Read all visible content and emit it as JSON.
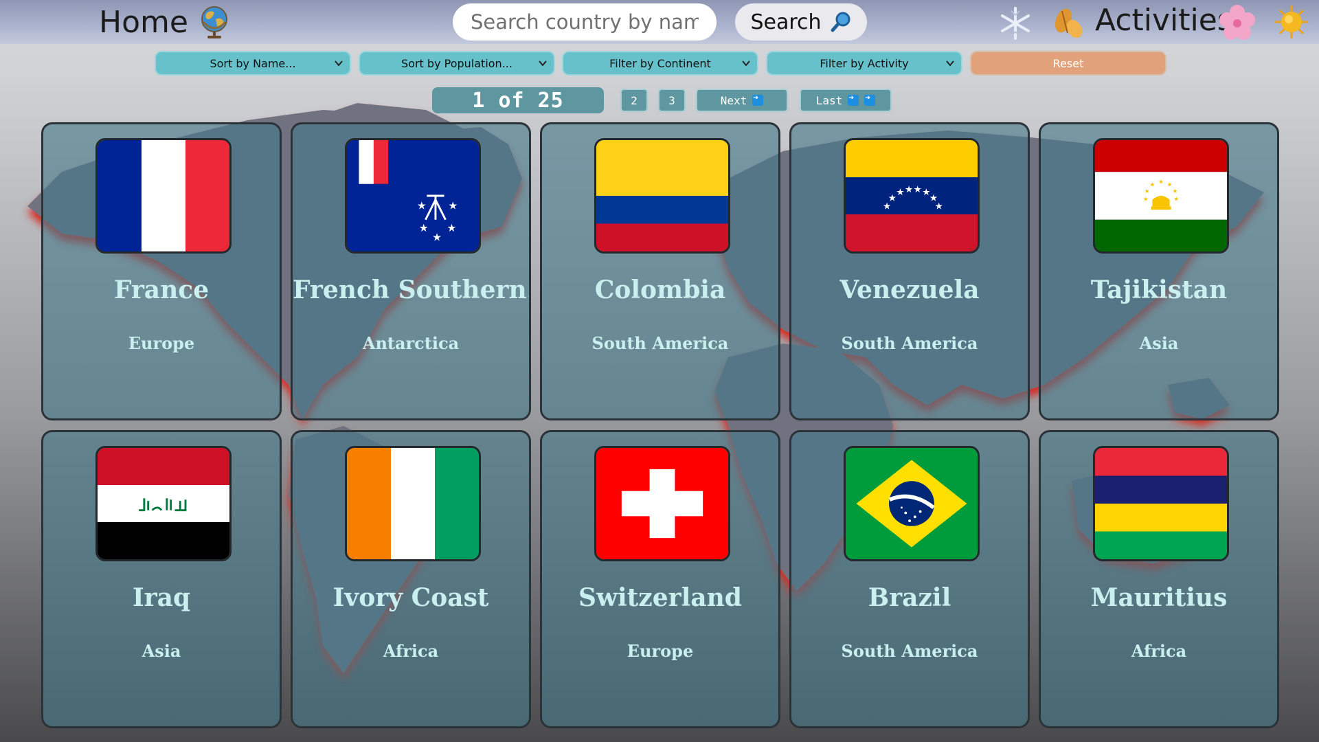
{
  "header": {
    "home_label": "Home",
    "search_placeholder": "Search country by name...",
    "search_button_label": "Search",
    "activities_label": "Activities",
    "icons": [
      "globe-icon",
      "magnifier-icon",
      "snowflake-icon",
      "autumn-leaf-icon",
      "blossom-icon",
      "sun-icon"
    ]
  },
  "filters": {
    "sort_by_name": "Sort by Name...",
    "sort_by_population": "Sort by Population...",
    "filter_by_continent": "Filter by Continent",
    "filter_by_activity": "Filter by Activity",
    "reset_label": "Reset"
  },
  "pagination": {
    "indicator": "1 of 25",
    "page2": "2",
    "page3": "3",
    "next_label": "Next",
    "last_label": "Last"
  },
  "countries": [
    {
      "name": "France",
      "continent": "Europe",
      "flag": "france"
    },
    {
      "name": "French Southern…",
      "continent": "Antarctica",
      "flag": "french-southern"
    },
    {
      "name": "Colombia",
      "continent": "South America",
      "flag": "colombia"
    },
    {
      "name": "Venezuela",
      "continent": "South America",
      "flag": "venezuela"
    },
    {
      "name": "Tajikistan",
      "continent": "Asia",
      "flag": "tajikistan"
    },
    {
      "name": "Iraq",
      "continent": "Asia",
      "flag": "iraq"
    },
    {
      "name": "Ivory Coast",
      "continent": "Africa",
      "flag": "ivory-coast"
    },
    {
      "name": "Switzerland",
      "continent": "Europe",
      "flag": "switzerland"
    },
    {
      "name": "Brazil",
      "continent": "South America",
      "flag": "brazil"
    },
    {
      "name": "Mauritius",
      "continent": "Africa",
      "flag": "mauritius"
    }
  ],
  "colors": {
    "header": "#a9b1cc",
    "filter_select": "#66c1cb",
    "reset": "#e0a17b",
    "card_overlay": "#467989",
    "card_text": "#c9efef",
    "map_land": "#6f7280",
    "map_edge": "#e6322c"
  }
}
